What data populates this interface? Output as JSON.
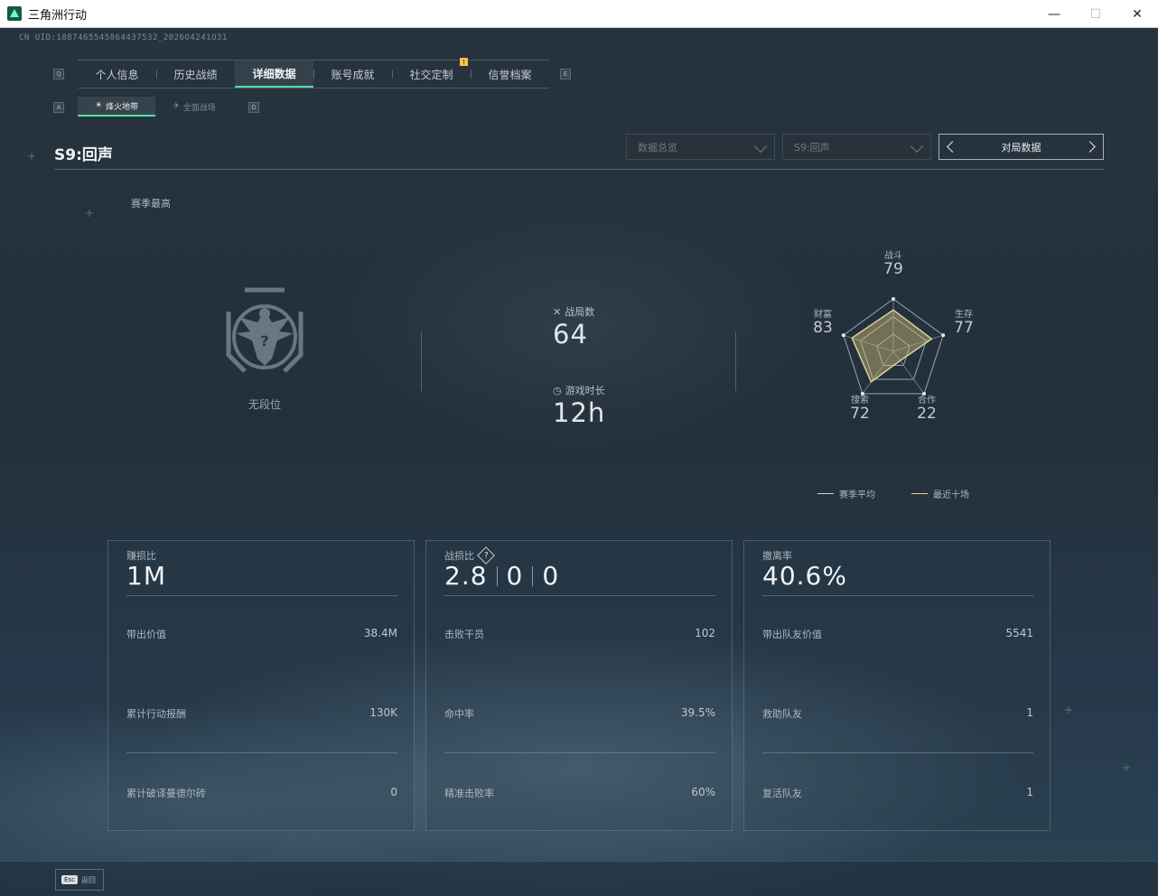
{
  "window": {
    "title": "三角洲行动",
    "minimize": "—",
    "maximize": "☐",
    "close": "✕"
  },
  "uid": "CN UID:1887465545864437532_2026O4241O31",
  "tabs": {
    "left_key": "Q",
    "right_key": "E",
    "items": [
      {
        "label": "个人信息"
      },
      {
        "label": "历史战绩"
      },
      {
        "label": "详细数据",
        "active": true
      },
      {
        "label": "账号成就"
      },
      {
        "label": "社交定制"
      },
      {
        "label": "信誉档案"
      }
    ],
    "badge": "!"
  },
  "subtabs": {
    "left_key": "A",
    "right_key": "D",
    "items": [
      {
        "label": "烽火地带",
        "icon": "sun-icon",
        "active": true
      },
      {
        "label": "全面战场",
        "icon": "plane-icon"
      }
    ]
  },
  "season": {
    "title": "S9:回声",
    "best_label": "赛季最高"
  },
  "filters": {
    "data_overview": "数据总览",
    "season_select": "S9:回声",
    "match_data": "对局数据"
  },
  "rank": {
    "label": "无段位",
    "icon": "eagle-emblem-icon"
  },
  "stats": {
    "matches_label": "战局数",
    "matches_value": "64",
    "playtime_label": "游戏时长",
    "playtime_value": "12h"
  },
  "radar": {
    "axes": [
      {
        "label": "战斗",
        "value": 79
      },
      {
        "label": "生存",
        "value": 77
      },
      {
        "label": "合作",
        "value": 22
      },
      {
        "label": "搜索",
        "value": 72
      },
      {
        "label": "财富",
        "value": 83
      }
    ],
    "series_colors": {
      "season_avg": "#c9d1d8",
      "recent_ten": "#e6cf7a"
    },
    "legend": {
      "season_avg": "赛季平均",
      "recent_ten": "最近十场"
    }
  },
  "cards": [
    {
      "title": "赚损比",
      "main": [
        "1M"
      ],
      "rows": [
        {
          "label": "带出价值",
          "value": "38.4M"
        },
        {
          "label": "累计行动报酬",
          "value": "130K"
        },
        {
          "label": "累计破译曼德尔砖",
          "value": "0"
        }
      ]
    },
    {
      "title": "战损比",
      "help": "?",
      "main": [
        "2.8",
        "0",
        "0"
      ],
      "rows": [
        {
          "label": "击败干员",
          "value": "102"
        },
        {
          "label": "命中率",
          "value": "39.5%"
        },
        {
          "label": "精准击败率",
          "value": "60%"
        }
      ]
    },
    {
      "title": "撤离率",
      "main": [
        "40.6%"
      ],
      "rows": [
        {
          "label": "带出队友价值",
          "value": "5541"
        },
        {
          "label": "救助队友",
          "value": "1"
        },
        {
          "label": "复活队友",
          "value": "1"
        }
      ]
    }
  ],
  "footer": {
    "esc_key": "Esc",
    "esc_label": "返回"
  }
}
